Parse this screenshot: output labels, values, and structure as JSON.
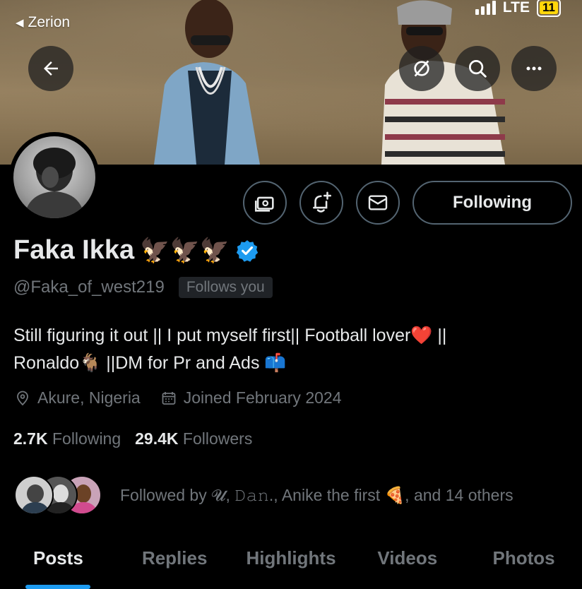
{
  "status_bar": {
    "back_label": "Zerion",
    "network": "LTE",
    "battery": "11"
  },
  "nav": {
    "back_icon": "arrow-left-icon",
    "grok_icon": "grok-icon",
    "search_icon": "search-icon",
    "more_icon": "more-horizontal-icon"
  },
  "profile": {
    "name": "Faka Ikka",
    "name_emojis": "🦅🦅🦅",
    "verified_color": "#1d9bf0",
    "handle": "@Faka_of_west219",
    "follows_you": "Follows you",
    "bio_line1": "Still figuring it out || I put myself first|| Football lover❤️ ||",
    "bio_line2": "Ronaldo🐐 ||DM for Pr and Ads 📫",
    "location": "Akure, Nigeria",
    "joined": "Joined February 2024",
    "following_count": "2.7K",
    "following_label": "Following",
    "followers_count": "29.4K",
    "followers_label": "Followers",
    "followed_by": "Followed by 𝓤, 𝙳𝚊𝚗., Anike the first 🍕, and 14 others"
  },
  "actions": {
    "subscribe_icon": "money-icon",
    "notify_icon": "bell-plus-icon",
    "message_icon": "envelope-icon",
    "following_button": "Following"
  },
  "tabs": [
    {
      "label": "Posts",
      "active": true
    },
    {
      "label": "Replies",
      "active": false
    },
    {
      "label": "Highlights",
      "active": false
    },
    {
      "label": "Videos",
      "active": false
    },
    {
      "label": "Photos",
      "active": false
    }
  ],
  "colors": {
    "accent": "#1d9bf0",
    "secondary_text": "#71767b",
    "background": "#000000"
  }
}
